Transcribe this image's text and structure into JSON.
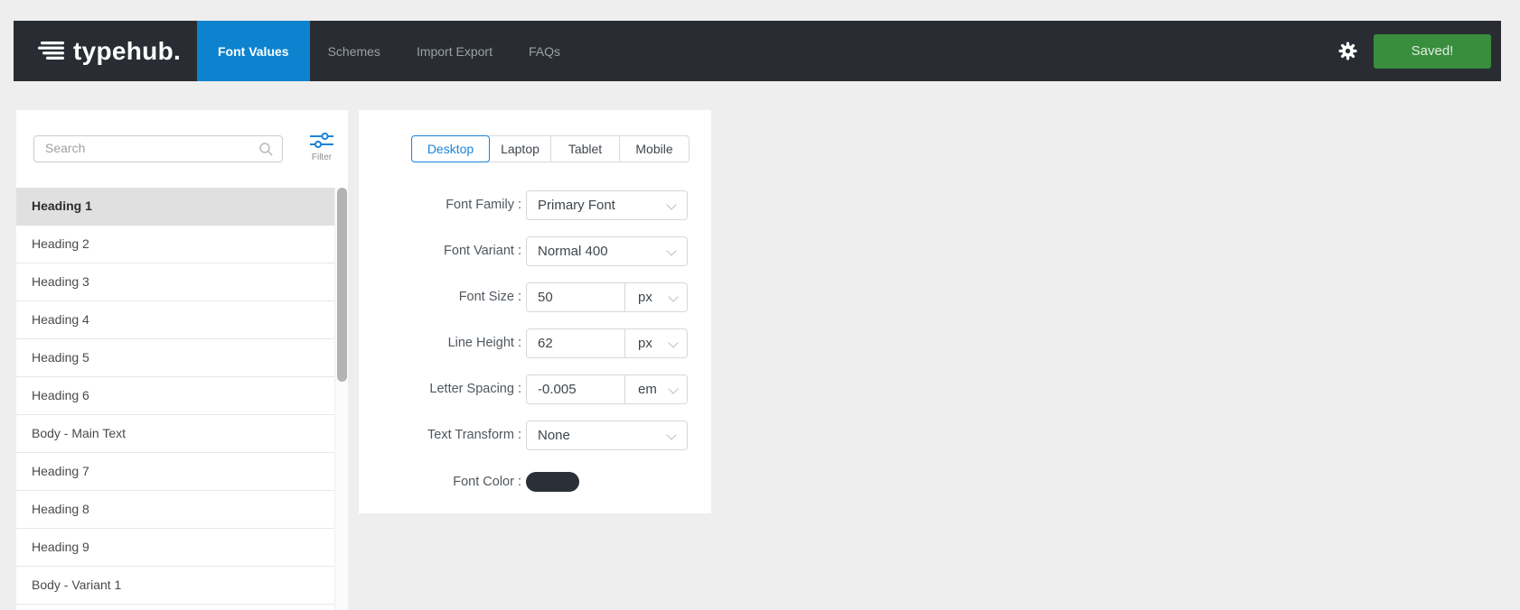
{
  "app": {
    "logo_text": "typehub."
  },
  "navbar": {
    "tabs": [
      {
        "label": "Font Values",
        "active": true
      },
      {
        "label": "Schemes",
        "active": false
      },
      {
        "label": "Import Export",
        "active": false
      },
      {
        "label": "FAQs",
        "active": false
      }
    ],
    "saved_button_label": "Saved!"
  },
  "sidebar": {
    "search_placeholder": "Search",
    "filter_label": "Filter",
    "items": [
      {
        "label": "Heading 1",
        "selected": true
      },
      {
        "label": "Heading 2",
        "selected": false
      },
      {
        "label": "Heading 3",
        "selected": false
      },
      {
        "label": "Heading 4",
        "selected": false
      },
      {
        "label": "Heading 5",
        "selected": false
      },
      {
        "label": "Heading 6",
        "selected": false
      },
      {
        "label": "Body - Main Text",
        "selected": false
      },
      {
        "label": "Heading 7",
        "selected": false
      },
      {
        "label": "Heading 8",
        "selected": false
      },
      {
        "label": "Heading 9",
        "selected": false
      },
      {
        "label": "Body - Variant 1",
        "selected": false
      }
    ]
  },
  "main": {
    "device_tabs": [
      {
        "label": "Desktop",
        "active": true
      },
      {
        "label": "Laptop",
        "active": false
      },
      {
        "label": "Tablet",
        "active": false
      },
      {
        "label": "Mobile",
        "active": false
      }
    ],
    "fields": [
      {
        "label": "Font Family :",
        "type": "select",
        "value": "Primary Font"
      },
      {
        "label": "Font Variant :",
        "type": "select",
        "value": "Normal 400"
      },
      {
        "label": "Font Size :",
        "type": "unit",
        "value": "50",
        "unit": "px"
      },
      {
        "label": "Line Height :",
        "type": "unit",
        "value": "62",
        "unit": "px"
      },
      {
        "label": "Letter Spacing :",
        "type": "unit",
        "value": "-0.005",
        "unit": "em"
      },
      {
        "label": "Text Transform :",
        "type": "select",
        "value": "None"
      },
      {
        "label": "Font Color :",
        "type": "color",
        "value": "#2b3038"
      }
    ]
  },
  "colors": {
    "navbar_dark": "#292d33",
    "nav_active_blue": "#0d83cf",
    "device_active_blue": "#1a84d8",
    "saved_green": "#388e3c",
    "selected_row_gray": "#e0e0e0",
    "font_color_swatch": "#2b3038"
  }
}
